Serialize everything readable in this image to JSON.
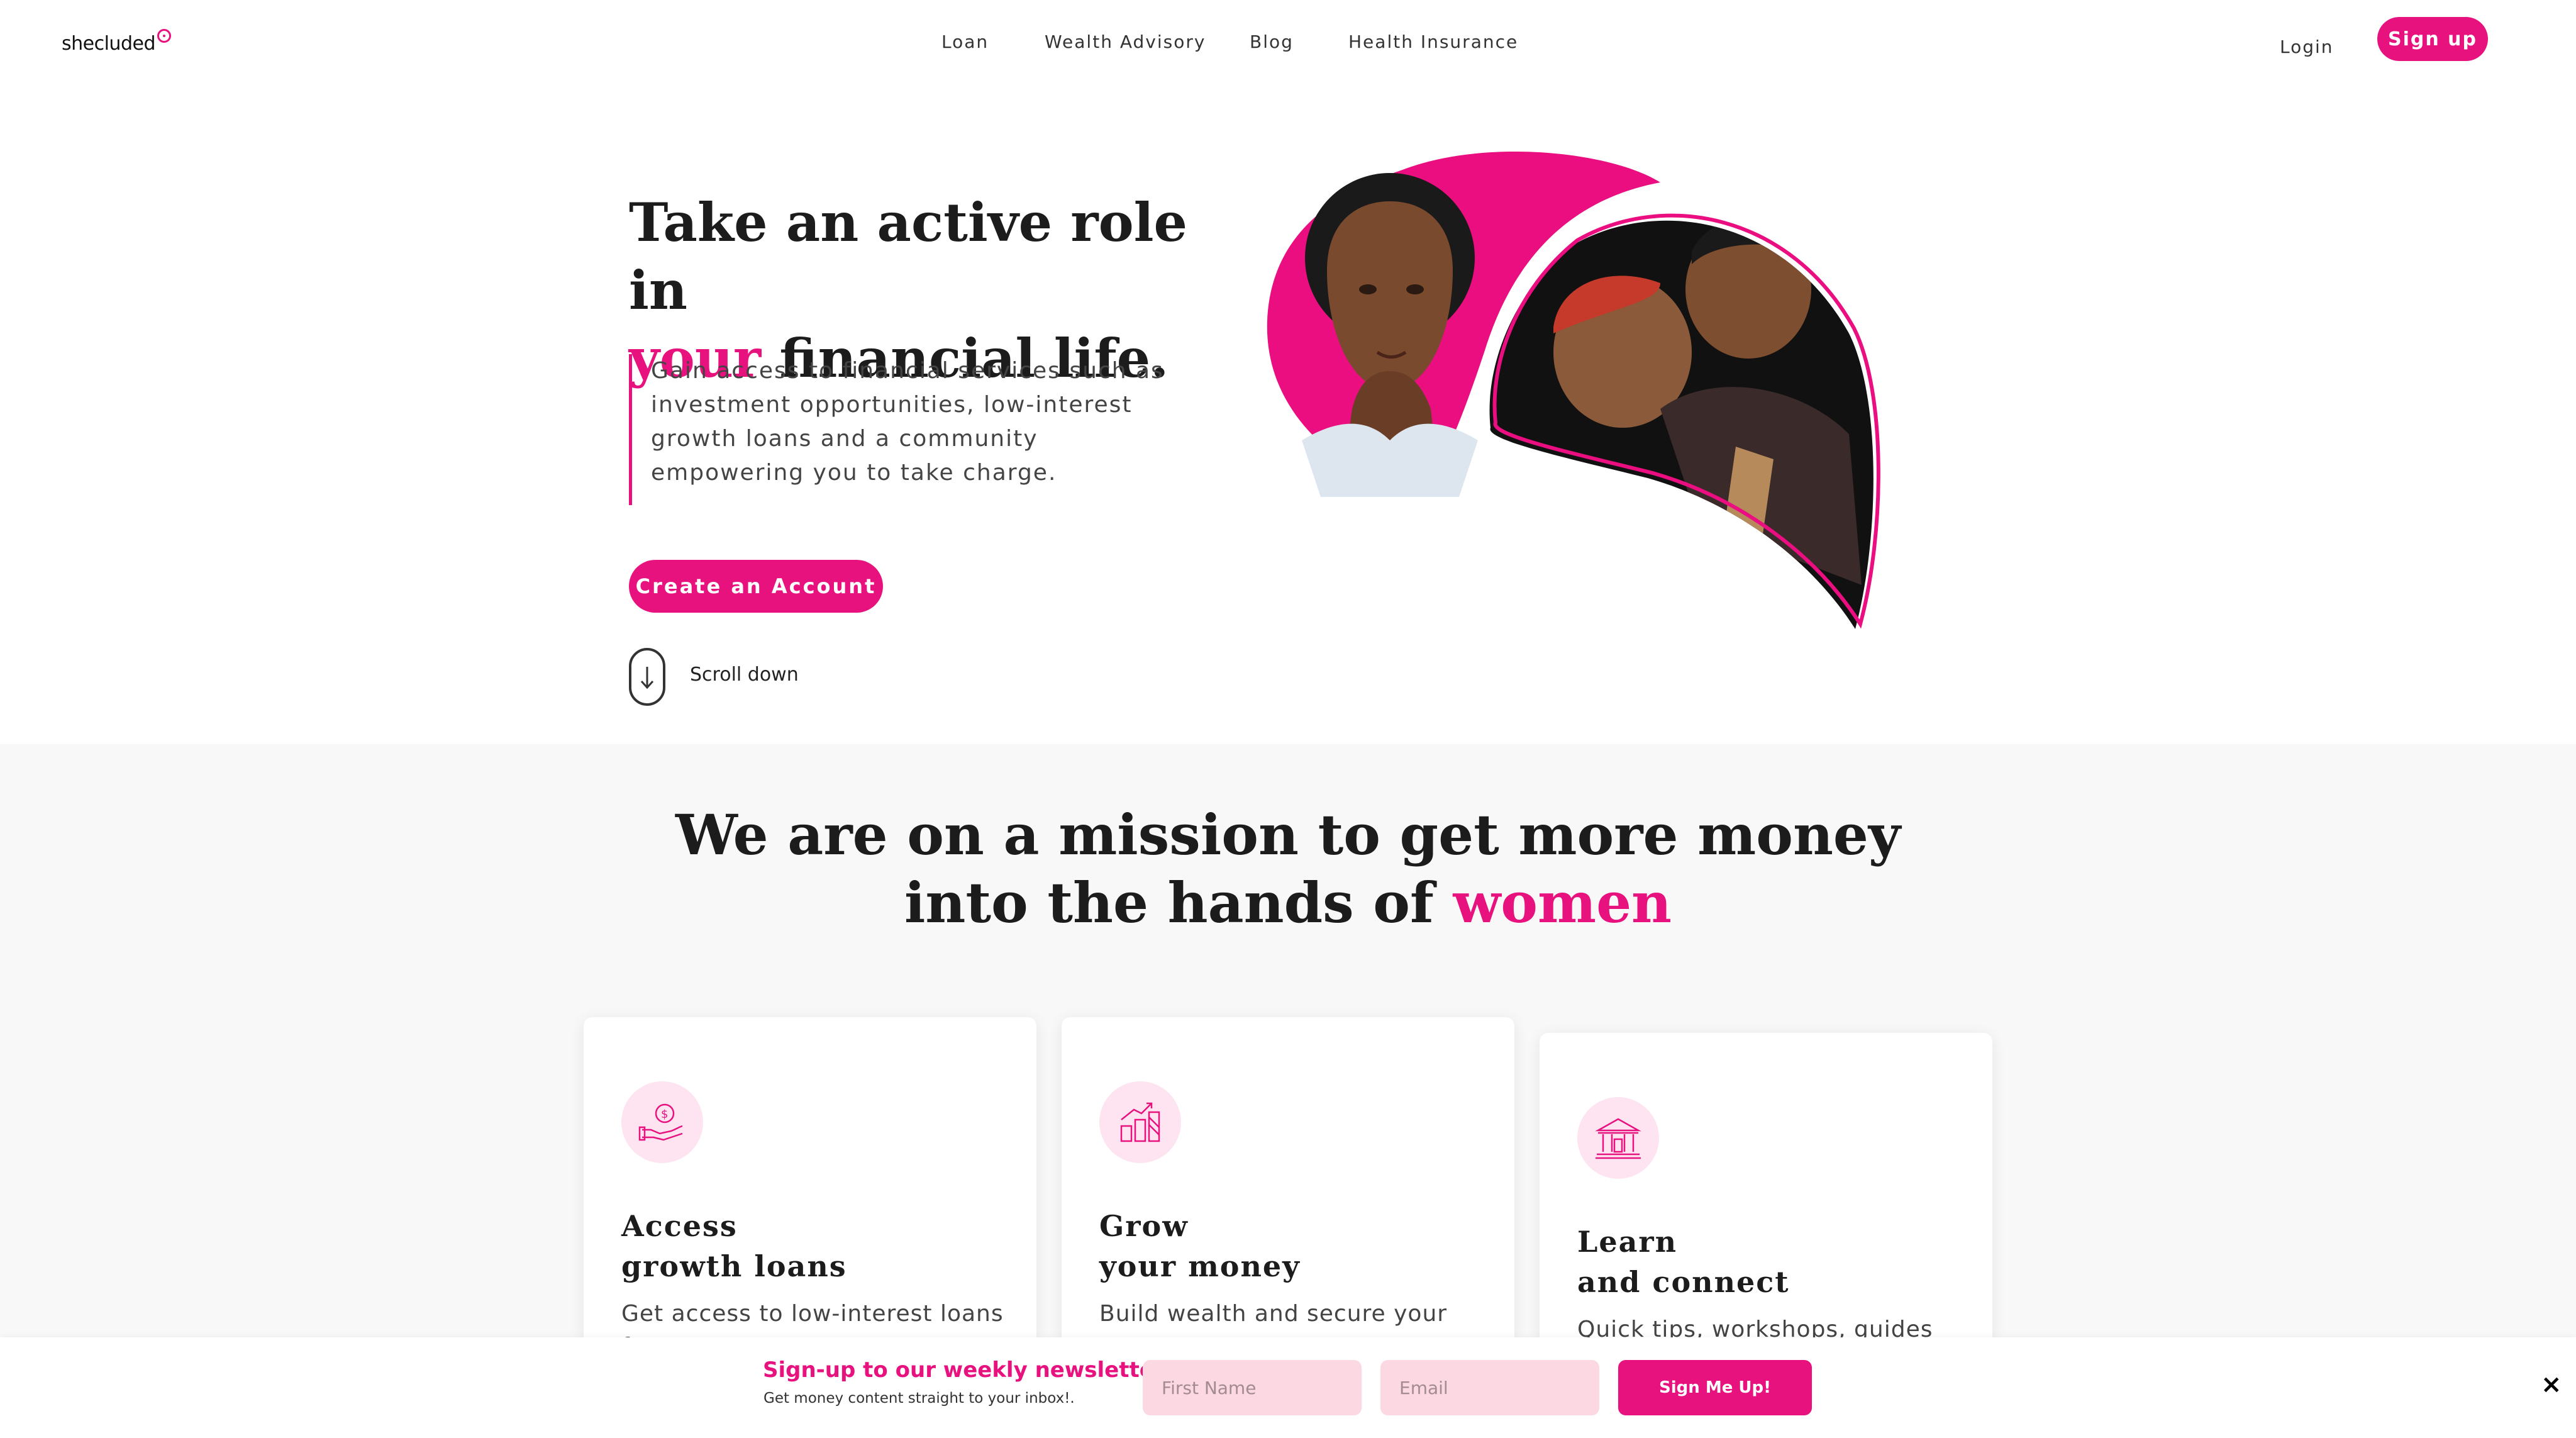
{
  "header": {
    "logo_text": "shecluded",
    "nav": [
      "Loan",
      "Wealth Advisory",
      "Blog",
      "Health Insurance"
    ],
    "login": "Login",
    "signup": "Sign up"
  },
  "hero": {
    "title_line1": "Take an active role in",
    "title_highlight": "your",
    "title_line2_rest": " financial life.",
    "description": "Gain access to financial services such as investment opportunities, low-interest growth loans and a community empowering you to take charge.",
    "cta": "Create an Account",
    "scroll_label": "Scroll down"
  },
  "mission": {
    "title_line1": "We are on a mission to get more money",
    "title_line2_prefix": "into the hands of ",
    "title_highlight": "women"
  },
  "cards": [
    {
      "icon": "money-hand-icon",
      "title_line1": "Access",
      "title_line2": "growth loans",
      "text": "Get access to low-interest loans for"
    },
    {
      "icon": "growth-chart-icon",
      "title_line1": "Grow",
      "title_line2": "your money",
      "text": "Build wealth and secure your"
    },
    {
      "icon": "bank-icon",
      "title_line1": "Learn",
      "title_line2": "and connect",
      "text": "Quick tips, workshops, guides and"
    }
  ],
  "newsletter": {
    "title": "Sign-up to our weekly newsletter",
    "subtitle": "Get money content straight to your inbox!.",
    "first_name_placeholder": "First Name",
    "email_placeholder": "Email",
    "button": "Sign Me Up!",
    "close": "×"
  },
  "colors": {
    "accent": "#e8127f",
    "input_bg": "#fbd8e2",
    "section_bg": "#f8f8f8"
  }
}
